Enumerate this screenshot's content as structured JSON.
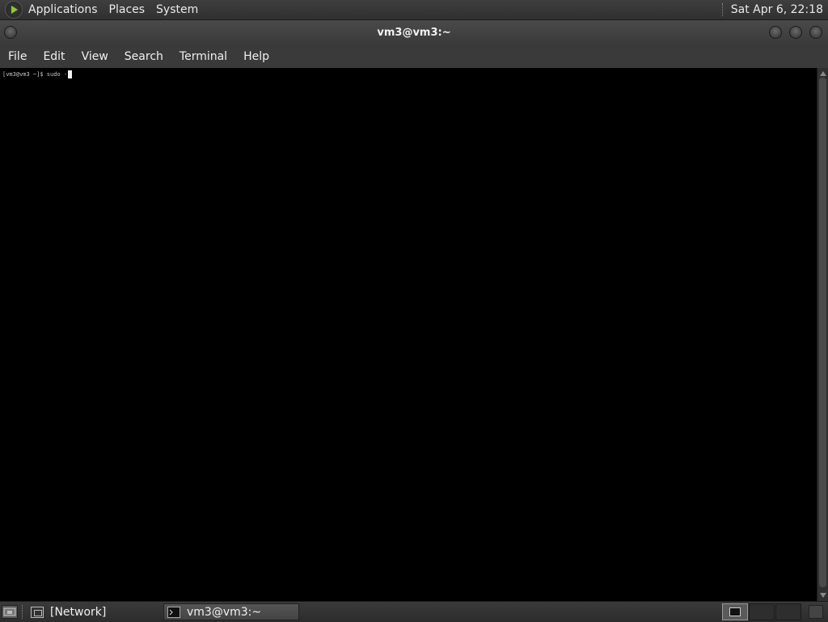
{
  "top_panel": {
    "logo_icon": "distro-logo-icon",
    "menus": [
      "Applications",
      "Places",
      "System"
    ],
    "clock": "Sat Apr  6, 22:18"
  },
  "window": {
    "title": "vm3@vm3:~",
    "menu": [
      "File",
      "Edit",
      "View",
      "Search",
      "Terminal",
      "Help"
    ]
  },
  "terminal": {
    "prompt": "[vm3@vm3 ~]$ ",
    "command": "sudo -"
  },
  "bottom_panel": {
    "tasks": [
      {
        "label": "[Network]",
        "icon": "window-stack-icon",
        "active": false
      },
      {
        "label": "vm3@vm3:~",
        "icon": "terminal-icon",
        "active": true
      }
    ],
    "workspaces": 3
  },
  "colors": {
    "panel_bg": "#333333",
    "terminal_bg": "#000000",
    "accent_logo": "#8fc540"
  }
}
